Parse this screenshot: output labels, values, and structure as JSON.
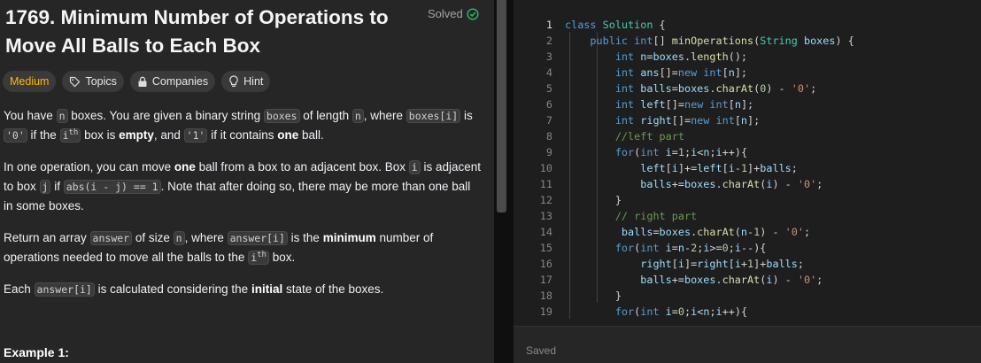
{
  "problem": {
    "title": "1769. Minimum Number of Operations to Move All Balls to Each Box",
    "solved_label": "Solved",
    "tags": [
      {
        "label": "Medium"
      },
      {
        "label": "Topics",
        "icon": "tag-icon"
      },
      {
        "label": "Companies",
        "icon": "lock-icon"
      },
      {
        "label": "Hint",
        "icon": "bulb-icon"
      }
    ],
    "p1": {
      "t1": "You have ",
      "c1": "n",
      "t2": " boxes. You are given a binary string ",
      "c2": "boxes",
      "t3": " of length ",
      "c3": "n",
      "t4": ", where ",
      "c4": "boxes[i]",
      "t5": " is ",
      "c5": "'0'",
      "t6": " if the ",
      "c6": "i",
      "sup1": "th",
      "t7": " box is ",
      "b1": "empty",
      "t8": ", and ",
      "c7": "'1'",
      "t9": " if it contains ",
      "b2": "one",
      "t10": " ball."
    },
    "p2": {
      "t1": "In one operation, you can move ",
      "b1": "one",
      "t2": " ball from a box to an adjacent box. Box ",
      "c1": "i",
      "t3": " is adjacent to box ",
      "c2": "j",
      "t4": " if ",
      "c3": "abs(i - j) == 1",
      "t5": ". Note that after doing so, there may be more than one ball in some boxes."
    },
    "p3": {
      "t1": "Return an array ",
      "c1": "answer",
      "t2": " of size ",
      "c2": "n",
      "t3": ", where ",
      "c3": "answer[i]",
      "t4": " is the ",
      "b1": "minimum",
      "t5": " number of operations needed to move all the balls to the ",
      "c4": "i",
      "sup1": "th",
      "t6": " box."
    },
    "p4": {
      "t1": "Each ",
      "c1": "answer[i]",
      "t2": " is calculated considering the ",
      "b1": "initial",
      "t3": " state of the boxes."
    },
    "example_label": "Example 1:"
  },
  "editor": {
    "saved_label": "Saved",
    "lines": [
      {
        "n": "1",
        "code": "class Solution {"
      },
      {
        "n": "2",
        "code": "    public int[] minOperations(String boxes) {"
      },
      {
        "n": "3",
        "code": "        int n=boxes.length();"
      },
      {
        "n": "4",
        "code": "        int ans[]=new int[n];"
      },
      {
        "n": "5",
        "code": "        int balls=boxes.charAt(0) - '0';"
      },
      {
        "n": "6",
        "code": "        int left[]=new int[n];"
      },
      {
        "n": "7",
        "code": "        int right[]=new int[n];"
      },
      {
        "n": "8",
        "code": "        //left part"
      },
      {
        "n": "9",
        "code": "        for(int i=1;i<n;i++){"
      },
      {
        "n": "10",
        "code": "            left[i]+=left[i-1]+balls;"
      },
      {
        "n": "11",
        "code": "            balls+=boxes.charAt(i) - '0';"
      },
      {
        "n": "12",
        "code": "        }"
      },
      {
        "n": "13",
        "code": "        // right part"
      },
      {
        "n": "14",
        "code": "         balls=boxes.charAt(n-1) - '0';"
      },
      {
        "n": "15",
        "code": "        for(int i=n-2;i>=0;i--){"
      },
      {
        "n": "16",
        "code": "            right[i]=right[i+1]+balls;"
      },
      {
        "n": "17",
        "code": "            balls+=boxes.charAt(i) - '0';"
      },
      {
        "n": "18",
        "code": "        }"
      },
      {
        "n": "19",
        "code": "        for(int i=0;i<n;i++){"
      }
    ]
  },
  "colors": {
    "accent_solved": "#2cbb5d",
    "medium": "#ffb800"
  }
}
